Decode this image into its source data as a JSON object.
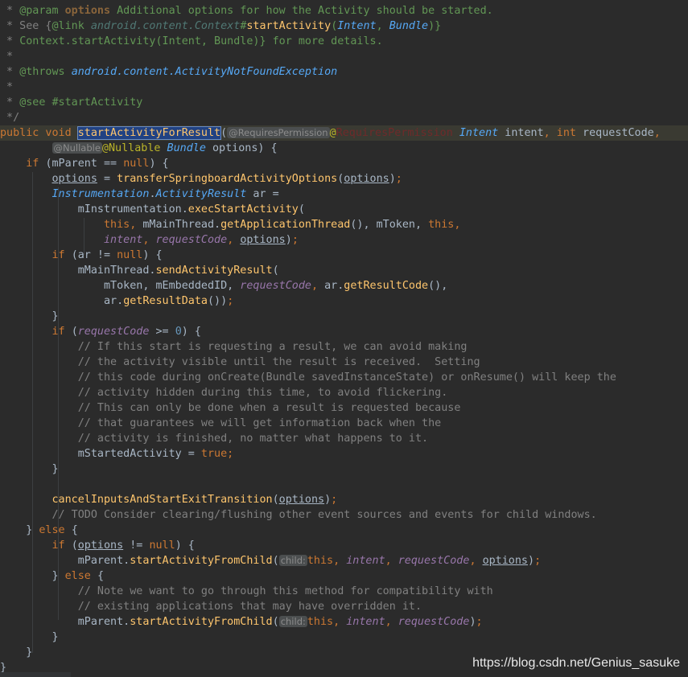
{
  "colors": {
    "background": "#2b2b2b",
    "keyword": "#cc7832",
    "method": "#ffc66d",
    "field": "#9876aa",
    "comment": "#808080",
    "doc_comment": "#629755",
    "number": "#6897bb",
    "type_italic": "#56a8f5",
    "selection": "#214283"
  },
  "code_lines": [
    [
      [
        "c",
        " * "
      ],
      [
        "d",
        "@param "
      ],
      [
        "dr",
        "options"
      ],
      [
        "d",
        " Additional options for how the Activity should be started."
      ]
    ],
    [
      [
        "c",
        " * See {"
      ],
      [
        "d",
        "@link "
      ],
      [
        "ty",
        "android.content.Context"
      ],
      [
        "d",
        "#"
      ],
      [
        "m",
        "startActivity"
      ],
      [
        "d",
        "("
      ],
      [
        "t",
        "Intent"
      ],
      [
        "d",
        ", "
      ],
      [
        "t",
        "Bundle"
      ],
      [
        "d",
        ")}"
      ]
    ],
    [
      [
        "c",
        " * "
      ],
      [
        "d",
        "Context.startActivity(Intent, Bundle)} for more details."
      ]
    ],
    [
      [
        "c",
        " *"
      ]
    ],
    [
      [
        "c",
        " * "
      ],
      [
        "d",
        "@throws "
      ],
      [
        "t",
        "android.content.ActivityNotFoundException"
      ]
    ],
    [
      [
        "c",
        " *"
      ]
    ],
    [
      [
        "c",
        " * "
      ],
      [
        "d",
        "@see #startActivity"
      ]
    ],
    [
      [
        "c",
        " */"
      ]
    ],
    [
      [
        "k",
        "public void "
      ],
      [
        "sel",
        "startActivityForResult"
      ],
      [
        "p",
        "("
      ],
      [
        "h",
        "@RequiresPermission"
      ],
      [
        "a",
        "@"
      ],
      [
        "ar",
        "RequiresPermission"
      ],
      [
        "p",
        " "
      ],
      [
        "t",
        "Intent"
      ],
      [
        "p",
        " intent"
      ],
      [
        "k",
        ", int "
      ],
      [
        "p",
        "requestCode"
      ],
      [
        "k",
        ","
      ]
    ],
    [
      [
        "p",
        "        "
      ],
      [
        "h",
        "@Nullable"
      ],
      [
        "a",
        "@Nullable "
      ],
      [
        "t",
        "Bundle"
      ],
      [
        "p",
        " options) {"
      ]
    ],
    [
      [
        "p",
        "    "
      ],
      [
        "k",
        "if "
      ],
      [
        "p",
        "(mParent == "
      ],
      [
        "k",
        "null"
      ],
      [
        "p",
        ") {"
      ]
    ],
    [
      [
        "p",
        "        "
      ],
      [
        "u",
        "options"
      ],
      [
        "p",
        " = "
      ],
      [
        "m",
        "transferSpringboardActivityOptions"
      ],
      [
        "p",
        "("
      ],
      [
        "u",
        "options"
      ],
      [
        "p",
        ")"
      ],
      [
        "k",
        ";"
      ]
    ],
    [
      [
        "p",
        "        "
      ],
      [
        "t",
        "Instrumentation"
      ],
      [
        "p",
        "."
      ],
      [
        "t",
        "ActivityResult"
      ],
      [
        "p",
        " ar ="
      ]
    ],
    [
      [
        "p",
        "            mInstrumentation."
      ],
      [
        "m",
        "execStartActivity"
      ],
      [
        "p",
        "("
      ]
    ],
    [
      [
        "p",
        "                "
      ],
      [
        "k",
        "this, "
      ],
      [
        "p",
        "mMainThread."
      ],
      [
        "m",
        "getApplicationThread"
      ],
      [
        "p",
        "(), mToken, "
      ],
      [
        "k",
        "this,"
      ]
    ],
    [
      [
        "p",
        "                "
      ],
      [
        "fn",
        "intent"
      ],
      [
        "k",
        ", "
      ],
      [
        "fn",
        "requestCode"
      ],
      [
        "k",
        ", "
      ],
      [
        "u",
        "options"
      ],
      [
        "p",
        ")"
      ],
      [
        "k",
        ";"
      ]
    ],
    [
      [
        "p",
        "        "
      ],
      [
        "k",
        "if "
      ],
      [
        "p",
        "(ar != "
      ],
      [
        "k",
        "null"
      ],
      [
        "p",
        ") {"
      ]
    ],
    [
      [
        "p",
        "            mMainThread."
      ],
      [
        "m",
        "sendActivityResult"
      ],
      [
        "p",
        "("
      ]
    ],
    [
      [
        "p",
        "                mToken, mEmbeddedID, "
      ],
      [
        "fn",
        "requestCode"
      ],
      [
        "k",
        ", "
      ],
      [
        "p",
        "ar."
      ],
      [
        "m",
        "getResultCode"
      ],
      [
        "p",
        "(),"
      ]
    ],
    [
      [
        "p",
        "                ar."
      ],
      [
        "m",
        "getResultData"
      ],
      [
        "p",
        "())"
      ],
      [
        "k",
        ";"
      ]
    ],
    [
      [
        "p",
        "        }"
      ]
    ],
    [
      [
        "p",
        "        "
      ],
      [
        "k",
        "if "
      ],
      [
        "p",
        "("
      ],
      [
        "fn",
        "requestCode"
      ],
      [
        "p",
        " >= "
      ],
      [
        "n",
        "0"
      ],
      [
        "p",
        ") {"
      ]
    ],
    [
      [
        "c",
        "            // If this start is requesting a result, we can avoid making"
      ]
    ],
    [
      [
        "c",
        "            // the activity visible until the result is received.  Setting"
      ]
    ],
    [
      [
        "c",
        "            // this code during onCreate(Bundle savedInstanceState) or onResume() will keep the"
      ]
    ],
    [
      [
        "c",
        "            // activity hidden during this time, to avoid flickering."
      ]
    ],
    [
      [
        "c",
        "            // This can only be done when a result is requested because"
      ]
    ],
    [
      [
        "c",
        "            // that guarantees we will get information back when the"
      ]
    ],
    [
      [
        "c",
        "            // activity is finished, no matter what happens to it."
      ]
    ],
    [
      [
        "p",
        "            mStartedActivity = "
      ],
      [
        "k",
        "true;"
      ]
    ],
    [
      [
        "p",
        "        }"
      ]
    ],
    [
      [
        "p",
        ""
      ]
    ],
    [
      [
        "p",
        "        "
      ],
      [
        "m",
        "cancelInputsAndStartExitTransition"
      ],
      [
        "p",
        "("
      ],
      [
        "u",
        "options"
      ],
      [
        "p",
        ")"
      ],
      [
        "k",
        ";"
      ]
    ],
    [
      [
        "c",
        "        // TODO Consider clearing/flushing other event sources and events for child windows."
      ]
    ],
    [
      [
        "p",
        "    } "
      ],
      [
        "k",
        "else "
      ],
      [
        "p",
        "{"
      ]
    ],
    [
      [
        "p",
        "        "
      ],
      [
        "k",
        "if "
      ],
      [
        "p",
        "("
      ],
      [
        "u",
        "options"
      ],
      [
        "p",
        " != "
      ],
      [
        "k",
        "null"
      ],
      [
        "p",
        ") {"
      ]
    ],
    [
      [
        "p",
        "            mParent."
      ],
      [
        "m",
        "startActivityFromChild"
      ],
      [
        "p",
        "("
      ],
      [
        "h",
        "child:"
      ],
      [
        "k",
        "this, "
      ],
      [
        "fn",
        "intent"
      ],
      [
        "k",
        ", "
      ],
      [
        "fn",
        "requestCode"
      ],
      [
        "k",
        ", "
      ],
      [
        "u",
        "options"
      ],
      [
        "p",
        ")"
      ],
      [
        "k",
        ";"
      ]
    ],
    [
      [
        "p",
        "        } "
      ],
      [
        "k",
        "else "
      ],
      [
        "p",
        "{"
      ]
    ],
    [
      [
        "c",
        "            // Note we want to go through this method for compatibility with"
      ]
    ],
    [
      [
        "c",
        "            // existing applications that may have overridden it."
      ]
    ],
    [
      [
        "p",
        "            mParent."
      ],
      [
        "m",
        "startActivityFromChild"
      ],
      [
        "p",
        "("
      ],
      [
        "h",
        "child:"
      ],
      [
        "k",
        "this, "
      ],
      [
        "fn",
        "intent"
      ],
      [
        "k",
        ", "
      ],
      [
        "fn",
        "requestCode"
      ],
      [
        "p",
        ")"
      ],
      [
        "k",
        ";"
      ]
    ],
    [
      [
        "p",
        "        }"
      ]
    ],
    [
      [
        "p",
        "    }"
      ]
    ],
    [
      [
        "p",
        "}"
      ]
    ]
  ],
  "watermark": "https://blog.csdn.net/Genius_sasuke"
}
